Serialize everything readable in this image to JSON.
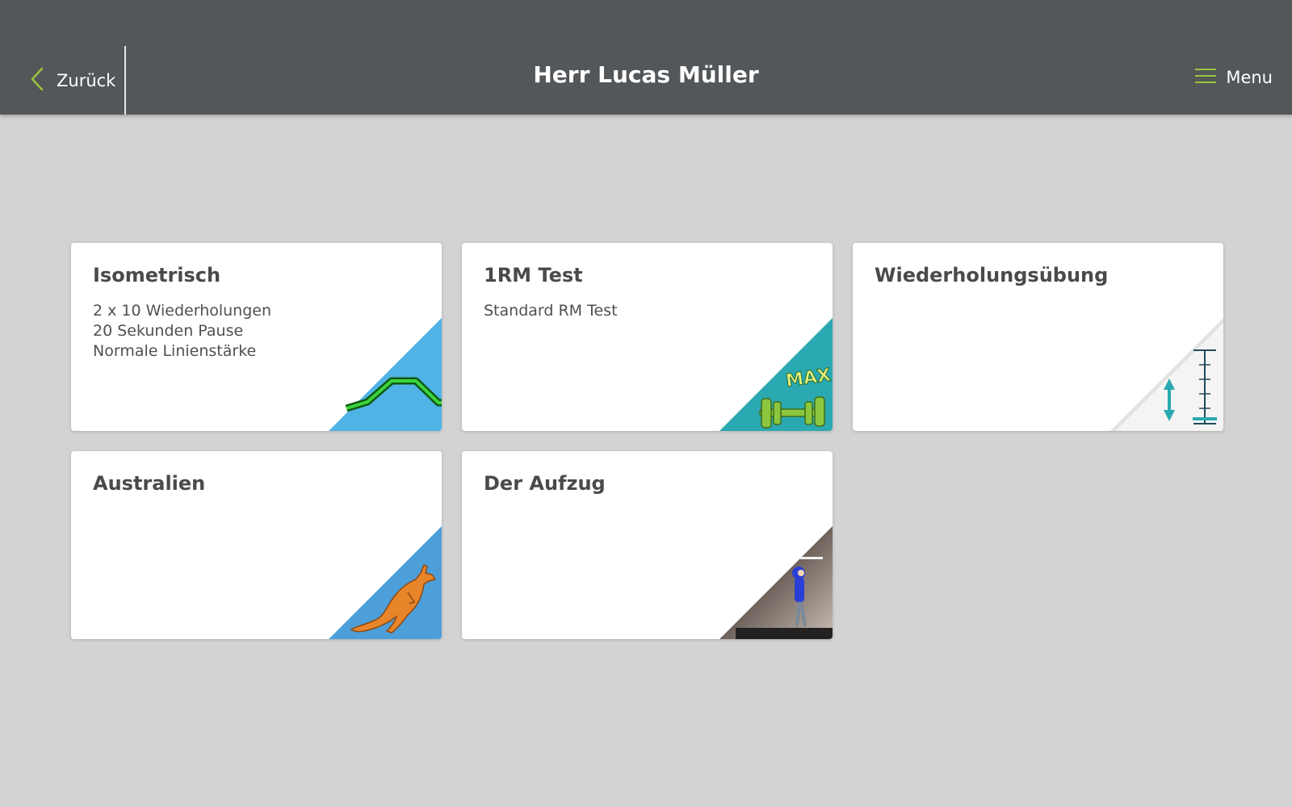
{
  "header": {
    "back_label": "Zurück",
    "title": "Herr Lucas Müller",
    "menu_label": "Menu",
    "accent_color": "#9bc43c",
    "background_color": "#53575a"
  },
  "cards": [
    {
      "title": "Isometrisch",
      "lines": [
        "2 x 10 Wiederholungen",
        "20 Sekunden Pause",
        "Normale Linienstärke"
      ],
      "corner_icon": "isometric-line-icon",
      "corner_color": "#4fb3e6"
    },
    {
      "title": "1RM Test",
      "lines": [
        "Standard RM Test"
      ],
      "corner_icon": "max-dumbbell-icon",
      "corner_color": "#2aa9b0",
      "corner_text": "MAX"
    },
    {
      "title": "Wiederholungsübung",
      "lines": [],
      "corner_icon": "repetition-scale-icon",
      "corner_color": "#f4f4f4"
    },
    {
      "title": "Australien",
      "lines": [],
      "corner_icon": "kangaroo-icon",
      "corner_color": "#4d9fd9"
    },
    {
      "title": "Der Aufzug",
      "lines": [],
      "corner_icon": "elevator-scene-icon",
      "corner_color": "#3a3533"
    }
  ]
}
